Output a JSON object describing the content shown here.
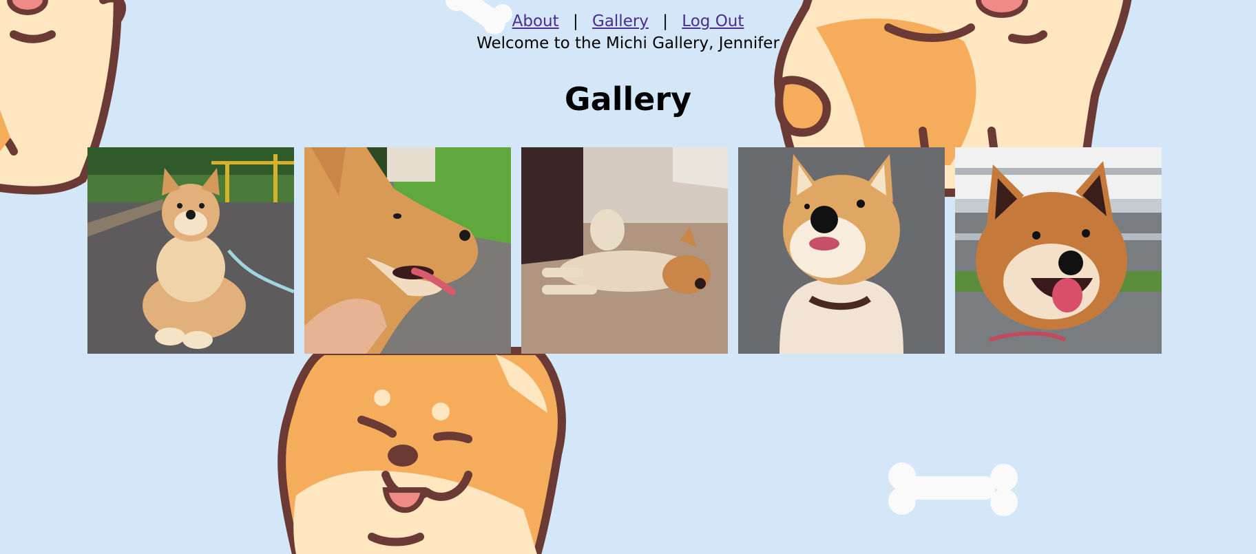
{
  "nav": {
    "links": [
      {
        "label": "About"
      },
      {
        "label": "Gallery"
      },
      {
        "label": "Log Out"
      }
    ],
    "separator": "|"
  },
  "welcome": "Welcome to the Michi Gallery, Jennifer",
  "page_title": "Gallery",
  "gallery": {
    "photos": [
      {
        "subject": "shiba lying on pavement with leash"
      },
      {
        "subject": "shiba side profile with hand"
      },
      {
        "subject": "shiba sleeping on carpet"
      },
      {
        "subject": "shiba looking up on asphalt"
      },
      {
        "subject": "shiba smiling by railing"
      }
    ]
  },
  "colors": {
    "background": "#d3e7f8",
    "link": "#4b2b8f",
    "shiba_orange": "#f6ad5b",
    "shiba_cream": "#fde6c0",
    "outline": "#6b3a34",
    "bone": "#fafafa"
  }
}
